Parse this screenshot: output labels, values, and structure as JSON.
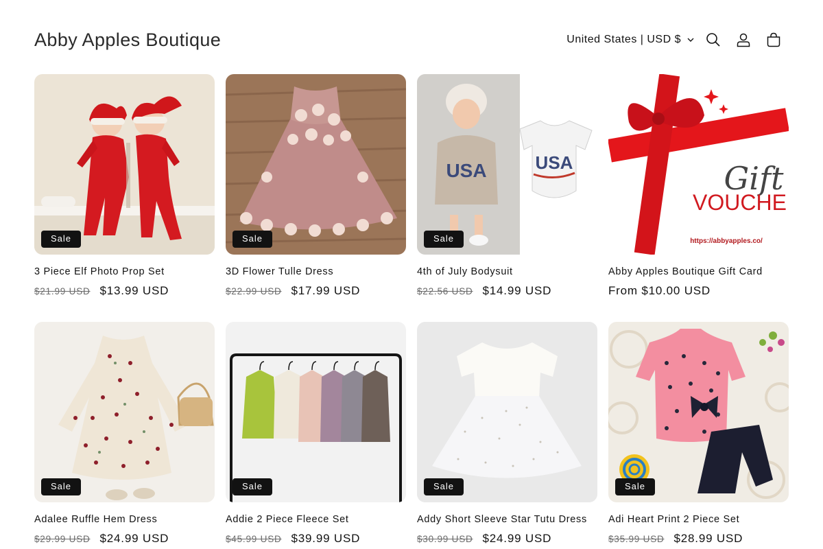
{
  "header": {
    "store_name": "Abby Apples Boutique",
    "country_selector": "United States | USD $",
    "icons": [
      "search-icon",
      "account-icon",
      "cart-icon"
    ]
  },
  "products": [
    {
      "title": "3 Piece Elf Photo Prop Set",
      "compare_price": "$21.99 USD",
      "price": "$13.99 USD",
      "badge": "Sale"
    },
    {
      "title": "3D Flower Tulle Dress",
      "compare_price": "$22.99 USD",
      "price": "$17.99 USD",
      "badge": "Sale"
    },
    {
      "title": "4th of July Bodysuit",
      "compare_price": "$22.56 USD",
      "price": "$14.99 USD",
      "badge": "Sale",
      "image_text": [
        "USA",
        "USA"
      ]
    },
    {
      "title": "Abby Apples Boutique Gift Card",
      "compare_price": "",
      "price": "From $10.00 USD",
      "badge": "",
      "image_text": [
        "Gift",
        "VOUCHE",
        "https://abbyapples.co/"
      ]
    },
    {
      "title": "Adalee Ruffle Hem Dress",
      "compare_price": "$29.99 USD",
      "price": "$24.99 USD",
      "badge": "Sale"
    },
    {
      "title": "Addie 2 Piece Fleece Set",
      "compare_price": "$45.99 USD",
      "price": "$39.99 USD",
      "badge": "Sale"
    },
    {
      "title": "Addy Short Sleeve Star Tutu Dress",
      "compare_price": "$30.99 USD",
      "price": "$24.99 USD",
      "badge": "Sale"
    },
    {
      "title": "Adi Heart Print 2 Piece Set",
      "compare_price": "$35.99 USD",
      "price": "$28.99 USD",
      "badge": "Sale"
    }
  ],
  "colors": {
    "text": "#121212",
    "badge_bg": "#121212",
    "badge_text": "#ffffff",
    "compare_text": "#6a6a6a",
    "background": "#ffffff"
  }
}
